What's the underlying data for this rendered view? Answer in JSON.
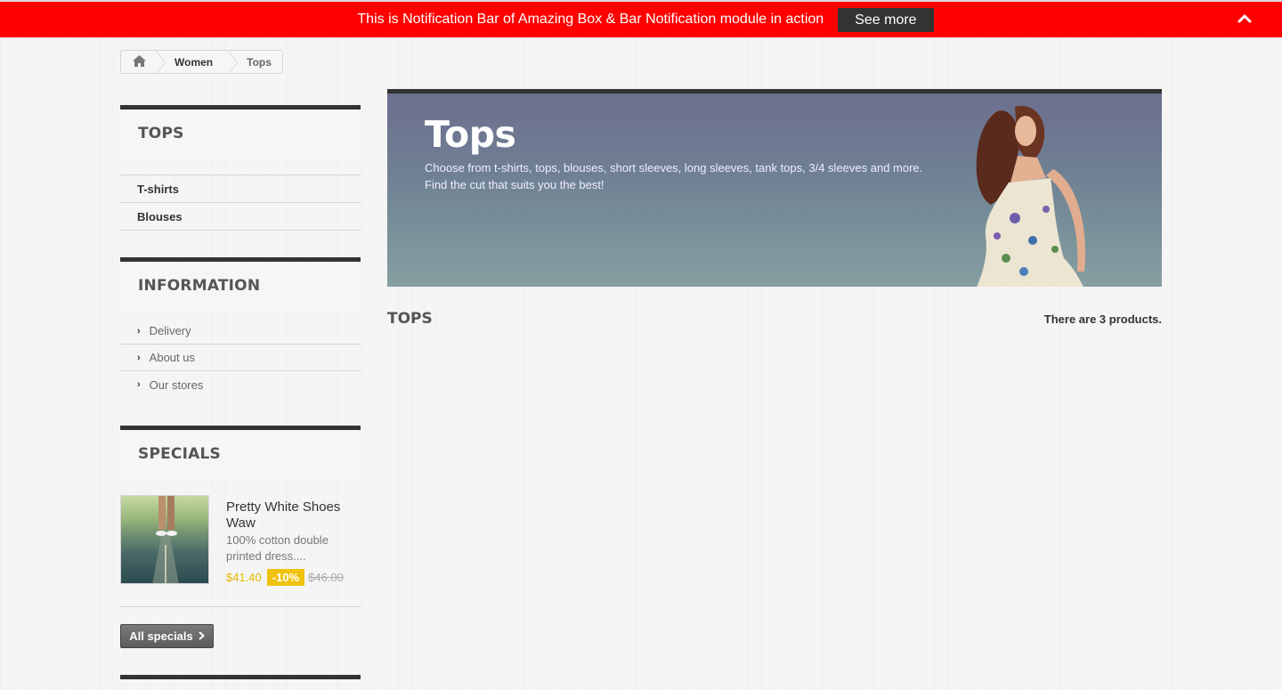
{
  "notification": {
    "text": "This is Notification Bar of Amazing Box & Bar Notification module in action",
    "button_label": "See more",
    "collapse_icon": "chevron-up-icon",
    "bar_color": "#ff0000"
  },
  "breadcrumb": {
    "home_icon": "home-icon",
    "items": [
      "Women",
      "Tops"
    ]
  },
  "categories_block": {
    "title": "TOPS",
    "items": [
      "T-shirts",
      "Blouses"
    ]
  },
  "information_block": {
    "title": "INFORMATION",
    "items": [
      "Delivery",
      "About us",
      "Our stores"
    ]
  },
  "specials_block": {
    "title": "SPECIALS",
    "product": {
      "name": "Pretty White Shoes Waw",
      "description": "100% cotton double printed dress....",
      "price": "$41.40",
      "discount": "-10%",
      "old_price": "$46.00"
    },
    "all_specials_label": "All specials",
    "accent_color": "#f0c20e"
  },
  "banner": {
    "title": "Tops",
    "description_line1": "Choose from t-shirts, tops, blouses, short sleeves, long sleeves, tank tops, 3/4 sleeves and more.",
    "description_line2": "Find the cut that suits you the best!"
  },
  "listing": {
    "title": "TOPS",
    "count_text": "There are 3 products."
  }
}
